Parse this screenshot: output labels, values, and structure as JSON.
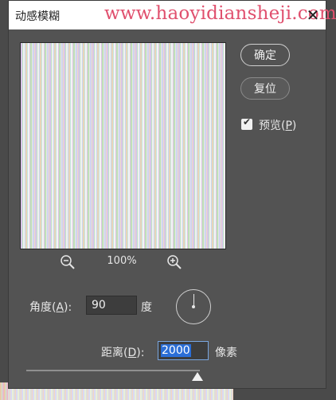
{
  "window": {
    "title": "动感模糊",
    "watermark": "www.haoyidiansheji.com",
    "close_glyph": "✕"
  },
  "buttons": {
    "ok": "确定",
    "reset": "复位"
  },
  "preview_toggle": {
    "label": "预览(",
    "mnemonic": "P",
    "suffix": ")",
    "checked": true
  },
  "zoom": {
    "level": "100%",
    "zoom_out_icon": "zoom-out-magnifier",
    "zoom_in_icon": "zoom-in-magnifier"
  },
  "angle": {
    "label": "角度(",
    "mnemonic": "A",
    "suffix": "):",
    "value": "90",
    "unit": "度"
  },
  "distance": {
    "label": "距离(",
    "mnemonic": "D",
    "suffix": "):",
    "value": "2000",
    "unit": "像素"
  },
  "colors": {
    "watermark": "#e0506e",
    "dialog_bg": "#535353",
    "selection": "#2b6ed6"
  }
}
